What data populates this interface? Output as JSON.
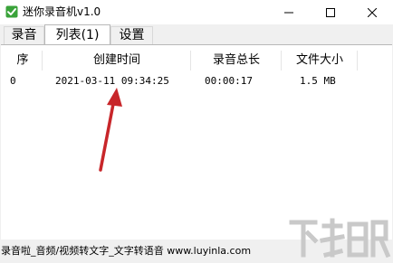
{
  "window": {
    "title": "迷你录音机v1.0",
    "icon": "checkmark-app-icon"
  },
  "title_buttons": {
    "minimize": "minimize-icon",
    "maximize": "maximize-icon",
    "close": "close-icon"
  },
  "tabs": [
    {
      "label": "录音",
      "selected": false
    },
    {
      "label": "列表(1)",
      "selected": true
    },
    {
      "label": "设置",
      "selected": false
    }
  ],
  "list": {
    "columns": [
      "序",
      "创建时间",
      "录音总长",
      "文件大小"
    ],
    "rows": [
      {
        "index": "0",
        "created": "2021-03-11 09:34:25",
        "duration": "00:00:17",
        "size": "1.5 MB"
      }
    ]
  },
  "status_bar": {
    "text": "录音啦_音频/视频转文字_文字转语音 www.luyinla.com"
  },
  "watermark": {
    "text": "下载吧"
  },
  "colors": {
    "annotation_arrow": "#c8262a",
    "icon_green": "#3aa33a",
    "window_bg": "#f0f0f0",
    "tab_border": "#d9d9d9",
    "watermark_gray": "#c9c9c9"
  }
}
